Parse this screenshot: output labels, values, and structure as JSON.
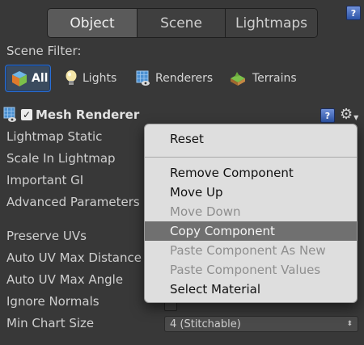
{
  "tabs": [
    {
      "label": "Object",
      "active": true
    },
    {
      "label": "Scene",
      "active": false
    },
    {
      "label": "Lightmaps",
      "active": false
    }
  ],
  "help_icon_glyph": "?",
  "scene_filter_label": "Scene Filter:",
  "filters": [
    {
      "label": "All",
      "icon": "cube-icon",
      "selected": true
    },
    {
      "label": "Lights",
      "icon": "lightbulb-icon",
      "selected": false
    },
    {
      "label": "Renderers",
      "icon": "renderer-icon",
      "selected": false
    },
    {
      "label": "Terrains",
      "icon": "terrain-icon",
      "selected": false
    }
  ],
  "component": {
    "enabled": true,
    "check_glyph": "✓",
    "title": "Mesh Renderer"
  },
  "properties": [
    "Lightmap Static",
    "Scale In Lightmap",
    "Important GI",
    "Advanced Parameters",
    "Preserve UVs",
    "Auto UV Max Distance",
    "Auto UV Max Angle",
    "Ignore Normals",
    "Min Chart Size"
  ],
  "min_chart_size_value": "4 (Stitchable)",
  "context_menu": {
    "items": [
      {
        "label": "Reset",
        "enabled": true,
        "highlighted": false
      },
      {
        "label": "Remove Component",
        "enabled": true,
        "highlighted": false
      },
      {
        "label": "Move Up",
        "enabled": true,
        "highlighted": false
      },
      {
        "label": "Move Down",
        "enabled": false,
        "highlighted": false
      },
      {
        "label": "Copy Component",
        "enabled": true,
        "highlighted": true
      },
      {
        "label": "Paste Component As New",
        "enabled": false,
        "highlighted": false
      },
      {
        "label": "Paste Component Values",
        "enabled": false,
        "highlighted": false
      },
      {
        "label": "Select Material",
        "enabled": true,
        "highlighted": false
      }
    ]
  },
  "colors": {
    "panel_bg": "#383838",
    "selection_accent": "#2a6fd6",
    "menu_bg": "#dedede",
    "menu_highlight": "#707070"
  }
}
